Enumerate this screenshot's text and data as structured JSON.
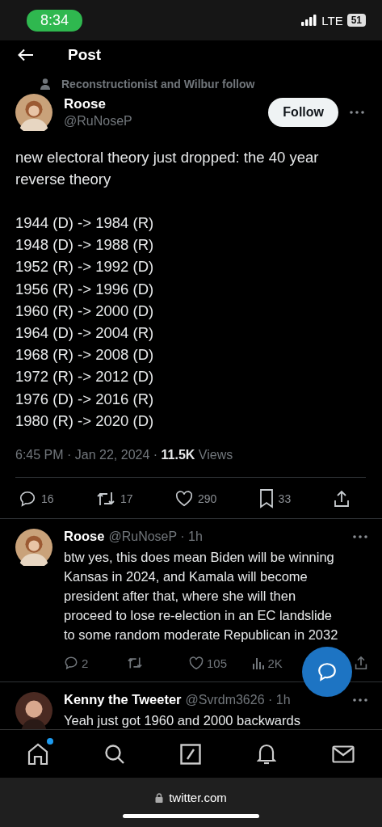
{
  "status_bar": {
    "time": "8:34",
    "network": "LTE",
    "battery": "51"
  },
  "header": {
    "title": "Post"
  },
  "post": {
    "social_context": "Reconstructionist and Wilbur follow",
    "author": "Roose",
    "handle": "@RuNoseP",
    "follow_button": "Follow",
    "intro": "new electoral theory just dropped: the 40 year reverse theory",
    "lines": [
      "1944 (D) -> 1984 (R)",
      "1948 (D) -> 1988 (R)",
      "1952 (R) -> 1992 (D)",
      "1956 (R) -> 1996 (D)",
      "1960 (R) -> 2000 (D)",
      "1964 (D) -> 2004 (R)",
      "1968 (R) -> 2008 (D)",
      "1972 (R) -> 2012 (D)",
      "1976 (D) -> 2016 (R)",
      "1980 (R) -> 2020 (D)"
    ],
    "meta": "6:45 PM · Jan 22, 2024 · **11.5K** Views",
    "actions": [
      {
        "kind": "reply",
        "count": "16"
      },
      {
        "kind": "repost",
        "count": "17"
      },
      {
        "kind": "like",
        "count": "290"
      },
      {
        "kind": "bookmark",
        "count": "33"
      },
      {
        "kind": "share"
      }
    ]
  },
  "replies": [
    {
      "author": "Roose",
      "handle": "@RuNoseP · 1h",
      "text": "btw yes, this does mean Biden will be winning Kansas in 2024, and Kamala will become president after that, where she will then proceed to lose re-election in an EC landslide to some random moderate Republican in 2032",
      "actions": [
        {
          "kind": "reply",
          "count": "2"
        },
        {
          "kind": "repost"
        },
        {
          "kind": "like",
          "count": "105"
        },
        {
          "kind": "views",
          "count": "2K"
        },
        {
          "kind": "share"
        }
      ]
    },
    {
      "author": "Kenny the Tweeter",
      "handle": "@Svrdm3626 · 1h",
      "text": "Yeah just got 1960 and 2000 backwards"
    }
  ],
  "tab_bar": [
    {
      "kind": "home",
      "dot": true
    },
    {
      "kind": "search",
      "dot": false
    },
    {
      "kind": "compose",
      "dot": false
    },
    {
      "kind": "notifications",
      "dot": false
    },
    {
      "kind": "messages",
      "dot": false
    }
  ],
  "browser": {
    "url": "twitter.com"
  }
}
